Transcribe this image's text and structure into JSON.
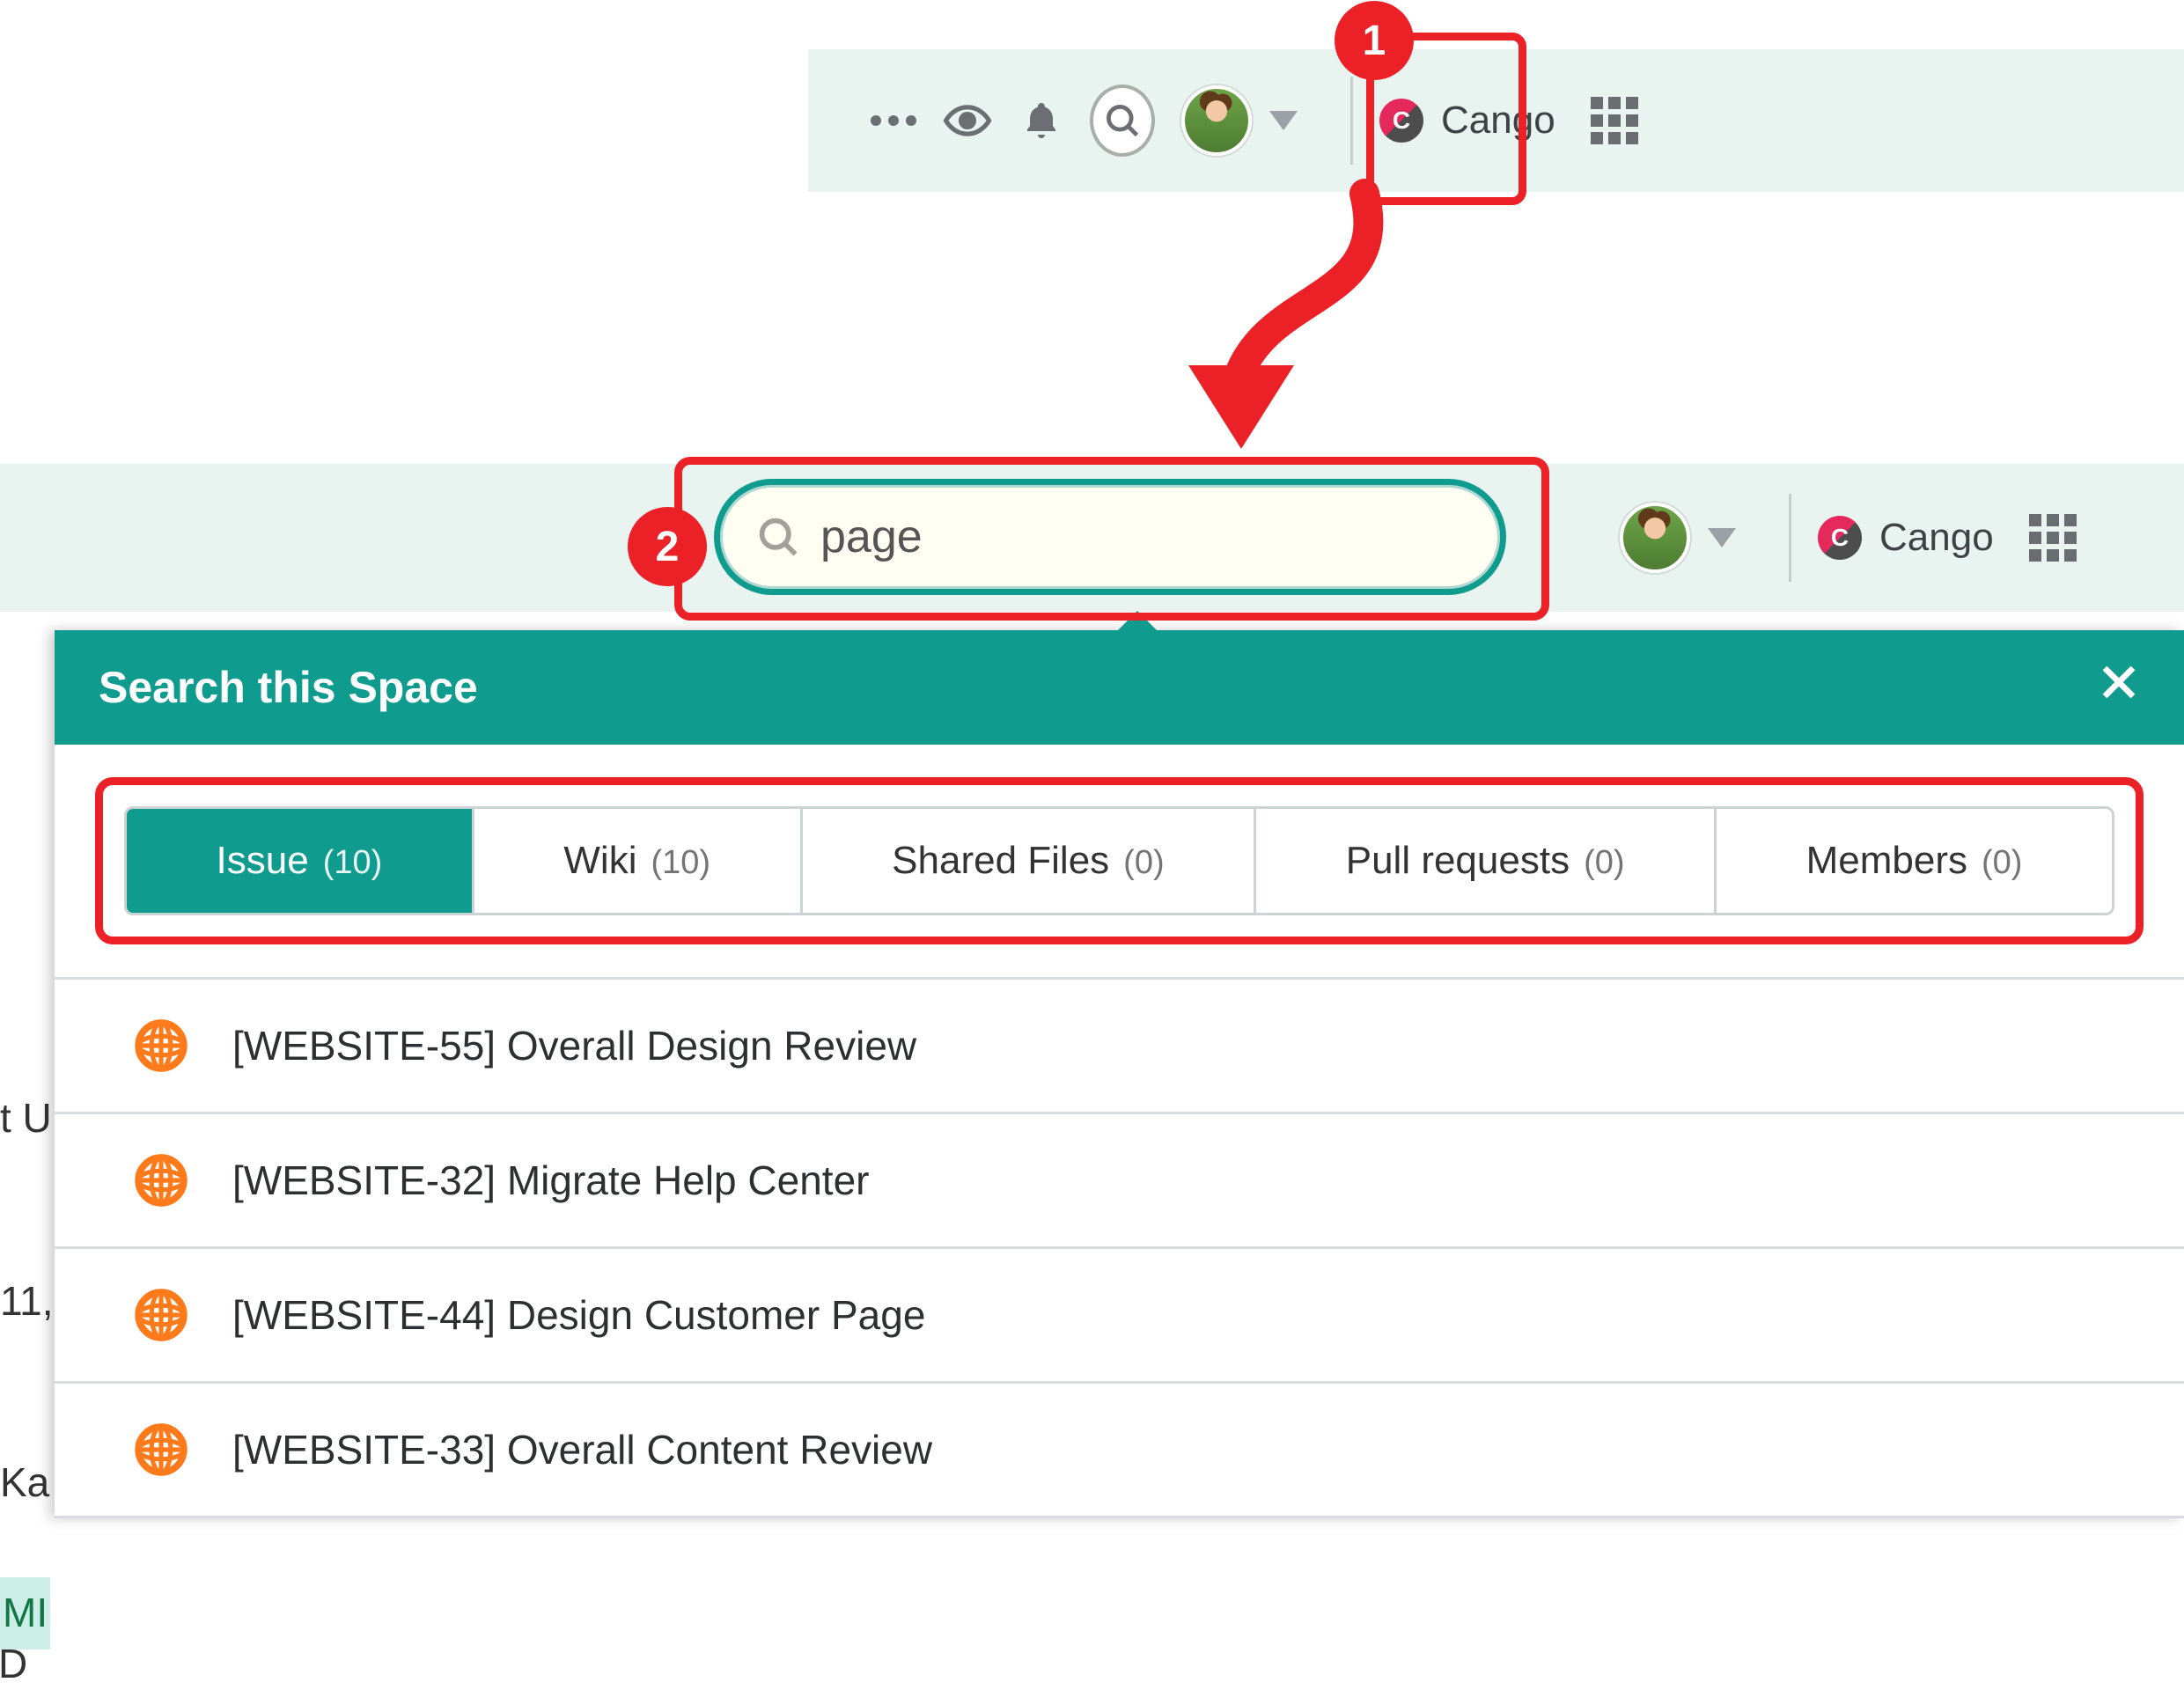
{
  "callouts": {
    "step1": "1",
    "step2": "2"
  },
  "toolbar": {
    "workspace_label": "Cango",
    "workspace_initial": "C"
  },
  "search": {
    "value": "page"
  },
  "panel": {
    "title": "Search this Space"
  },
  "tabs": [
    {
      "label": "Issue",
      "count": "(10)",
      "active": true
    },
    {
      "label": "Wiki",
      "count": "(10)",
      "active": false
    },
    {
      "label": "Shared Files",
      "count": "(0)",
      "active": false
    },
    {
      "label": "Pull requests",
      "count": "(0)",
      "active": false
    },
    {
      "label": "Members",
      "count": "(0)",
      "active": false
    }
  ],
  "results": [
    {
      "title": "[WEBSITE-55] Overall Design Review"
    },
    {
      "title": "[WEBSITE-32] Migrate Help Center"
    },
    {
      "title": "[WEBSITE-44] Design Customer Page"
    },
    {
      "title": "[WEBSITE-33] Overall Content Review"
    }
  ],
  "bg_fragments": {
    "t1": "t U",
    "t2": "11,",
    "t3": "Ka",
    "t4": "MI",
    "t5": "D"
  }
}
